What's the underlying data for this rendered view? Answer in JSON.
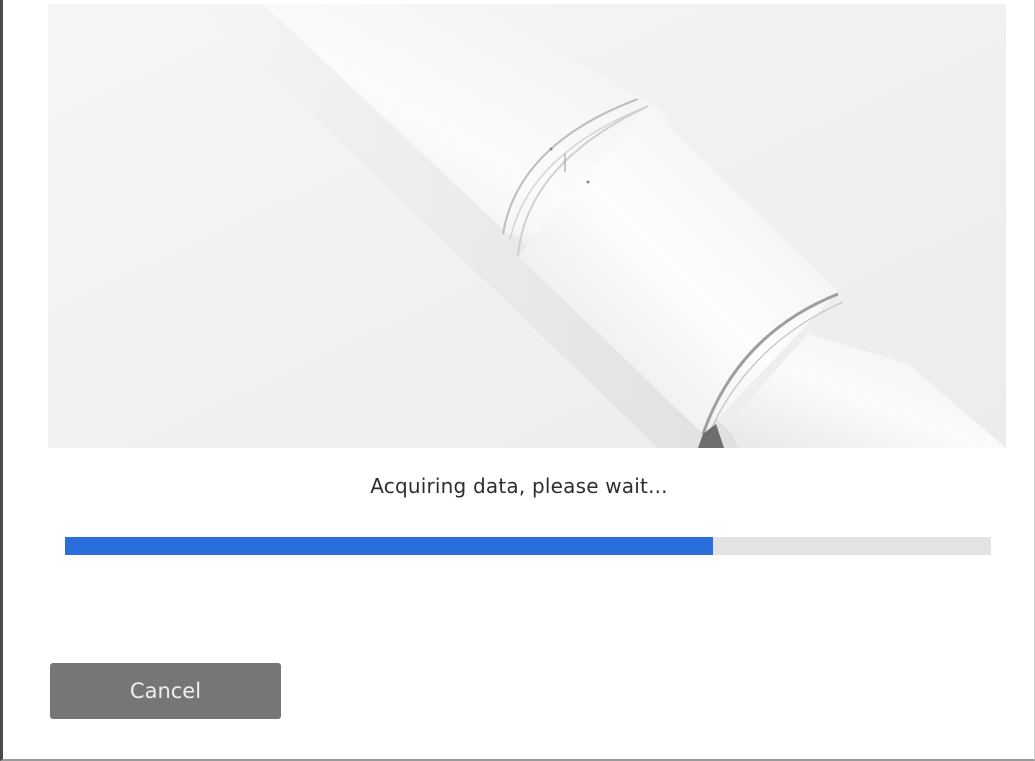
{
  "dialog": {
    "status_text": "Acquiring data, please wait...",
    "progress_fraction": 0.7,
    "cancel_label": "Cancel"
  },
  "colors": {
    "progress_fill": "#2a6fdb",
    "progress_track": "#e3e3e3",
    "button_bg": "#767679",
    "button_text": "#eeeeee",
    "hero_bg": "#f1f1f1"
  },
  "hero_image": {
    "subject": "white cylindrical device sections"
  }
}
